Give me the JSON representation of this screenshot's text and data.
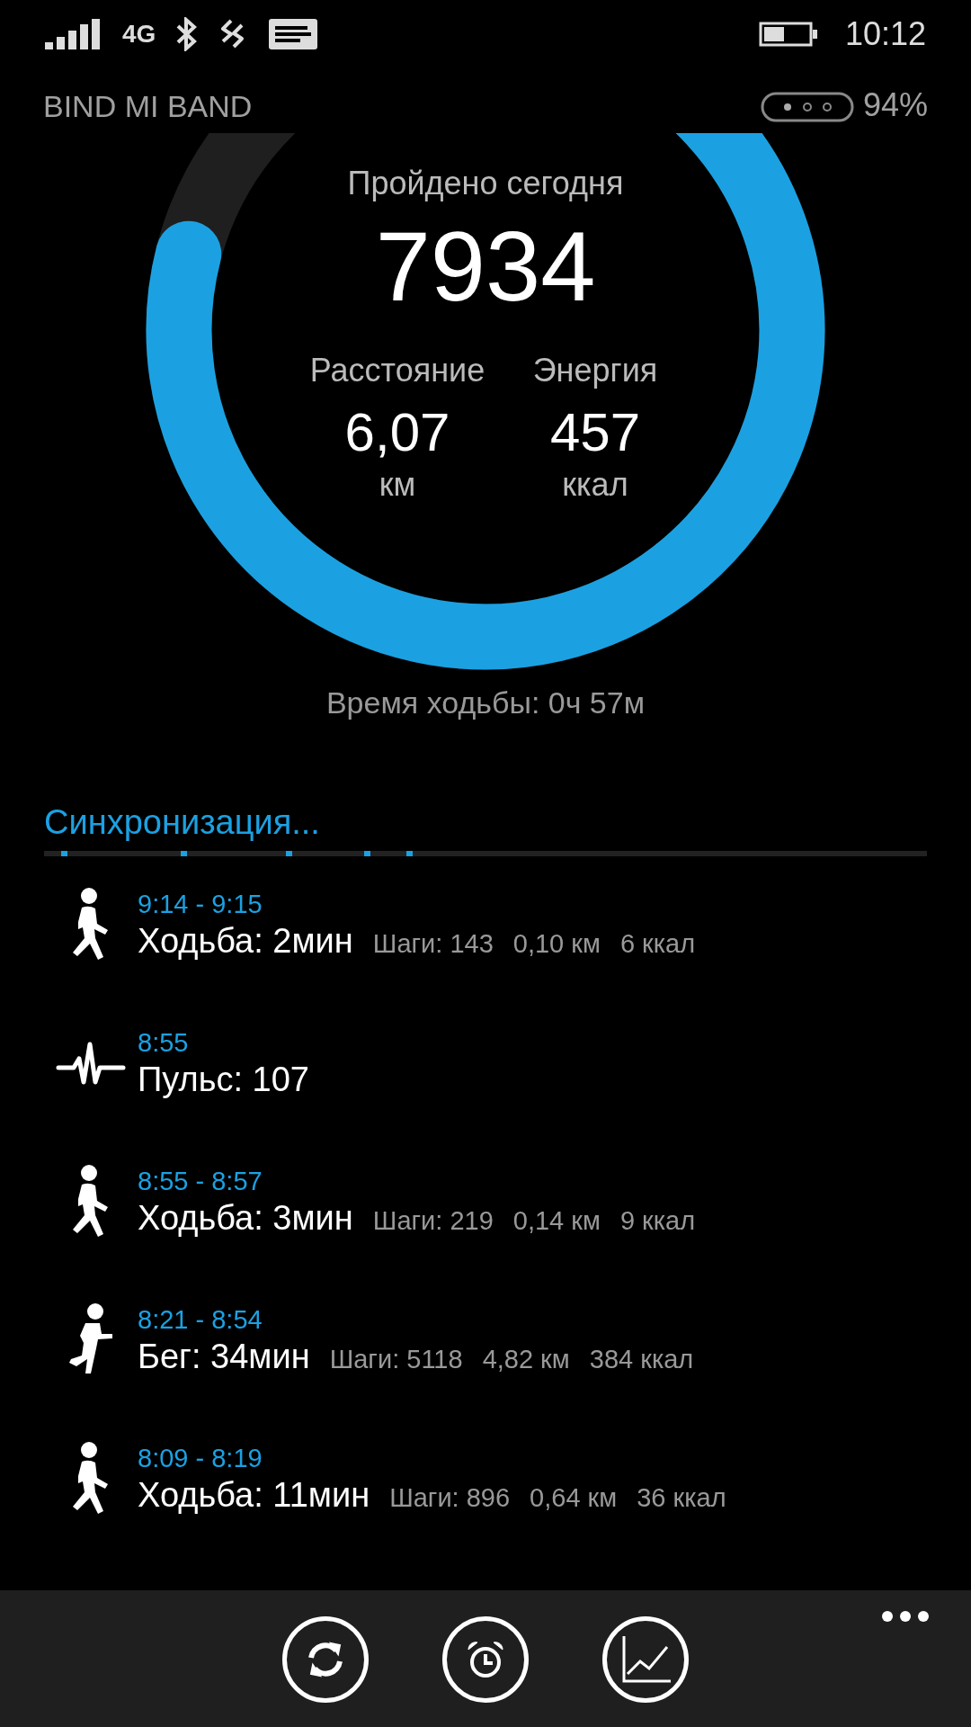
{
  "status_bar": {
    "network": "4G",
    "time": "10:12"
  },
  "header": {
    "title": "BIND MI BAND",
    "battery": "94%"
  },
  "ring": {
    "label": "Пройдено сегодня",
    "steps": "7934",
    "stats": [
      {
        "label": "Расстояние",
        "value": "6,07",
        "unit": "км"
      },
      {
        "label": "Энергия",
        "value": "457",
        "unit": "ккал"
      }
    ]
  },
  "walk_time": "Время ходьбы: 0ч 57м",
  "sync": {
    "title": "Синхронизация...",
    "indeterminate": true
  },
  "activities": [
    {
      "kind": "walk",
      "time": "9:14 - 9:15",
      "title": "Ходьба: 2мин",
      "details": [
        "Шаги: 143",
        "0,10 км",
        "6 ккал"
      ]
    },
    {
      "kind": "pulse",
      "time": "8:55",
      "title": "Пульс: 107"
    },
    {
      "kind": "walk",
      "time": "8:55 - 8:57",
      "title": "Ходьба: 3мин",
      "details": [
        "Шаги: 219",
        "0,14 км",
        "9 ккал"
      ]
    },
    {
      "kind": "run",
      "time": "8:21 - 8:54",
      "title": "Бег: 34мин",
      "details": [
        "Шаги: 5118",
        "4,82 км",
        "384 ккал"
      ]
    },
    {
      "kind": "walk",
      "time": "8:09 - 8:19",
      "title": "Ходьба: 11мин",
      "details": [
        "Шаги: 896",
        "0,64 км",
        "36 ккал"
      ]
    }
  ]
}
